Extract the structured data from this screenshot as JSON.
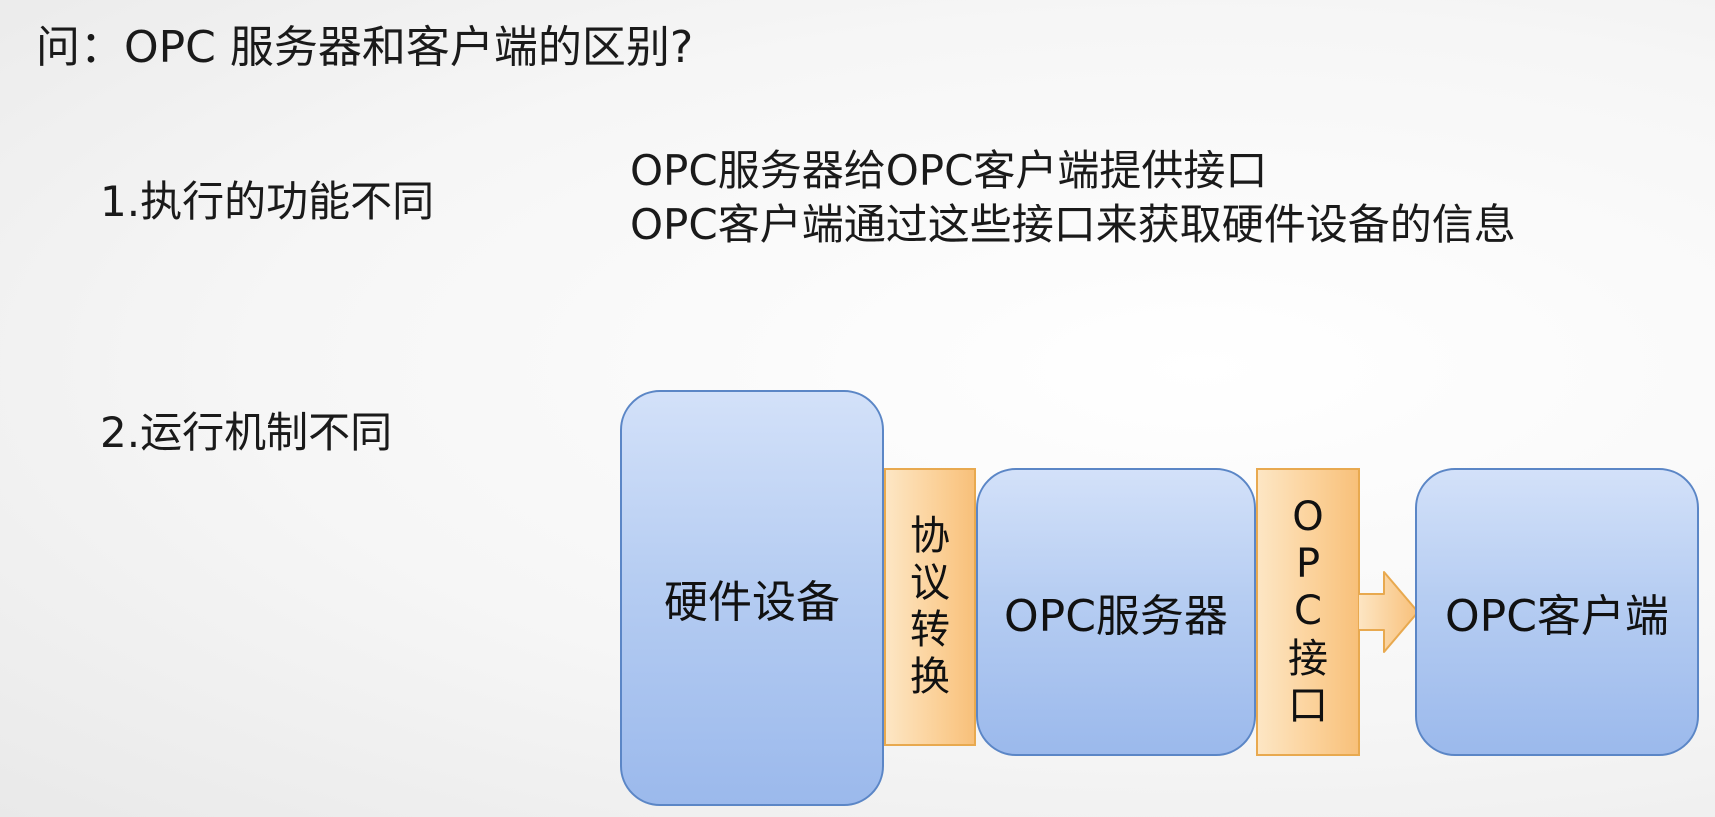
{
  "title": "问：OPC 服务器和客户端的区别?",
  "points": [
    {
      "label": "1.执行的功能不同"
    },
    {
      "label": "2.运行机制不同"
    }
  ],
  "description": [
    "OPC服务器给OPC客户端提供接口",
    "OPC客户端通过这些接口来获取硬件设备的信息"
  ],
  "diagram": {
    "hardware": "硬件设备",
    "protocol_chars": [
      "协",
      "议",
      "转",
      "换"
    ],
    "server": "OPC服务器",
    "interface_chars": [
      "O",
      "P",
      "C",
      "接",
      "口"
    ],
    "client": "OPC客户端"
  },
  "colors": {
    "box_fill": "#b6cdf2",
    "box_border": "#5b86c6",
    "strip_fill": "#fbd097",
    "strip_border": "#e8a94f"
  }
}
